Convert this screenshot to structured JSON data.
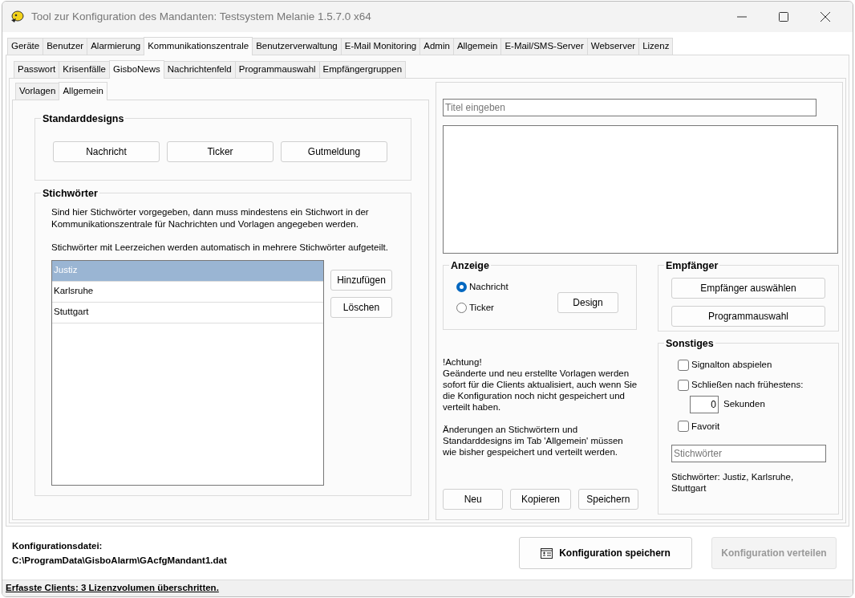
{
  "window": {
    "title": "Tool zur Konfiguration des Mandanten: Testsystem Melanie 1.5.7.0 x64"
  },
  "main_tabs": [
    {
      "label": "Geräte",
      "selected": false
    },
    {
      "label": "Benutzer",
      "selected": false
    },
    {
      "label": "Alarmierung",
      "selected": false
    },
    {
      "label": "Kommunikationszentrale",
      "selected": true
    },
    {
      "label": "Benutzerverwaltung",
      "selected": false
    },
    {
      "label": "E-Mail Monitoring",
      "selected": false
    },
    {
      "label": "Admin",
      "selected": false
    },
    {
      "label": "Allgemein",
      "selected": false
    },
    {
      "label": "E-Mail/SMS-Server",
      "selected": false
    },
    {
      "label": "Webserver",
      "selected": false
    },
    {
      "label": "Lizenz",
      "selected": false
    }
  ],
  "sub_tabs": [
    {
      "label": "Passwort",
      "selected": false
    },
    {
      "label": "Krisenfälle",
      "selected": false
    },
    {
      "label": "GisboNews",
      "selected": true
    },
    {
      "label": "Nachrichtenfeld",
      "selected": false
    },
    {
      "label": "Programmauswahl",
      "selected": false
    },
    {
      "label": "Empfängergruppen",
      "selected": false
    }
  ],
  "page_tabs": [
    {
      "label": "Vorlagen",
      "selected": false
    },
    {
      "label": "Allgemein",
      "selected": true
    }
  ],
  "standard_designs": {
    "title": "Standarddesigns",
    "buttons": [
      "Nachricht",
      "Ticker",
      "Gutmeldung"
    ]
  },
  "keywords": {
    "title": "Stichwörter",
    "hint_1": "Sind hier Stichwörter vorgegeben, dann muss mindestens ein Stichwort in der Kommunikationszentrale für Nachrichten und Vorlagen angegeben werden.",
    "hint_2": "Stichwörter mit Leerzeichen werden automatisch in mehrere Stichwörter aufgeteilt.",
    "items": [
      {
        "label": "Justiz",
        "selected": true
      },
      {
        "label": "Karlsruhe",
        "selected": false
      },
      {
        "label": "Stuttgart",
        "selected": false
      }
    ],
    "buttons": [
      "Hinzufügen",
      "Löschen"
    ]
  },
  "editor": {
    "title_placeholder": "Titel eingeben"
  },
  "display": {
    "title": "Anzeige",
    "options": [
      {
        "label": "Nachricht",
        "selected": true
      },
      {
        "label": "Ticker",
        "selected": false
      }
    ],
    "design_button": "Design"
  },
  "notice": {
    "heading": "!Achtung!",
    "paragraphs": [
      "Geänderte und neu erstellte Vorlagen werden sofort für die Clients aktualisiert, auch wenn Sie die Konfiguration noch nicht gespeichert und verteilt haben.",
      "Änderungen an Stichwörtern und Standarddesigns im Tab 'Allgemein' müssen wie bisher gespeichert und verteilt werden."
    ]
  },
  "template_buttons": [
    "Neu",
    "Kopieren",
    "Speichern"
  ],
  "recipients": {
    "title": "Empfänger",
    "buttons": [
      "Empfänger auswählen",
      "Programmauswahl"
    ]
  },
  "misc": {
    "title": "Sonstiges",
    "items": [
      {
        "kind": "checkbox",
        "label": "Signalton abspielen",
        "checked": false
      },
      {
        "kind": "checkbox",
        "label": "Schließen nach frühestens:",
        "checked": false
      },
      {
        "kind": "number",
        "value": "0",
        "label": "Sekunden"
      },
      {
        "kind": "checkbox",
        "label": "Favorit",
        "checked": false
      }
    ],
    "keyword_placeholder": "Stichwörter",
    "keyword_summary": "Stichwörter: Justiz, Karlsruhe, Stuttgart"
  },
  "footer": {
    "file_label": "Konfigurationsdatei:",
    "file_path": "C:\\ProgramData\\GisboAlarm\\GAcfgMandant1.dat",
    "save_button": "Konfiguration speichern",
    "distribute_button": {
      "label": "Konfiguration verteilen",
      "disabled": true
    }
  },
  "status_bar": {
    "text": "Erfasste Clients: 3 Lizenzvolumen überschritten."
  }
}
